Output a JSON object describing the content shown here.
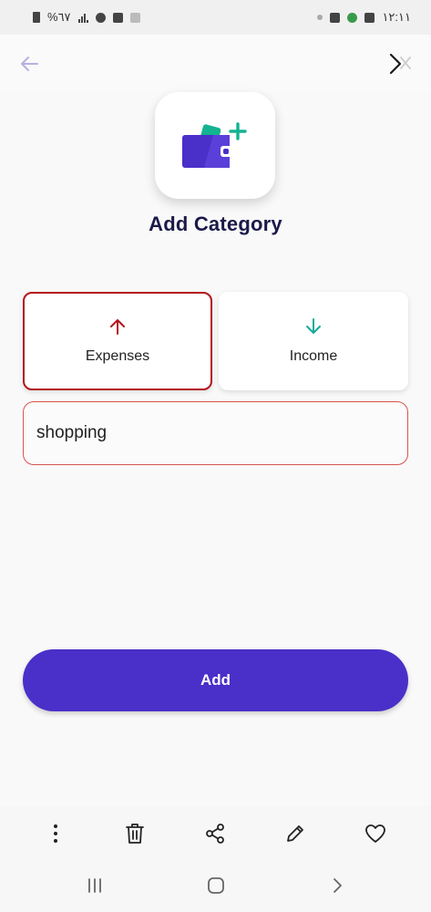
{
  "status_bar": {
    "battery_text": "%٦٧",
    "time": "١٢:١١"
  },
  "header": {
    "back_icon": "arrow-left-icon",
    "close_icon": "close-icon"
  },
  "app_icon": "wallet-plus-icon",
  "page": {
    "title": "Add Category"
  },
  "type_options": [
    {
      "label": "Expenses",
      "icon": "arrow-up-icon",
      "color": "#b3151c",
      "selected": true
    },
    {
      "label": "Income",
      "icon": "arrow-down-icon",
      "color": "#1aa99a",
      "selected": false
    }
  ],
  "category_input": {
    "value": "shopping"
  },
  "add_button": {
    "label": "Add"
  },
  "colors": {
    "accent": "#4a2fc9",
    "title": "#1b1a4a",
    "expense": "#b3151c",
    "income": "#1aa99a",
    "input_border": "#d9534f"
  },
  "toolbar_icons": [
    "more-vertical-icon",
    "trash-icon",
    "share-icon",
    "pencil-icon",
    "heart-icon"
  ],
  "nav_icons": [
    "recent-apps-icon",
    "home-icon",
    "back-nav-icon"
  ]
}
